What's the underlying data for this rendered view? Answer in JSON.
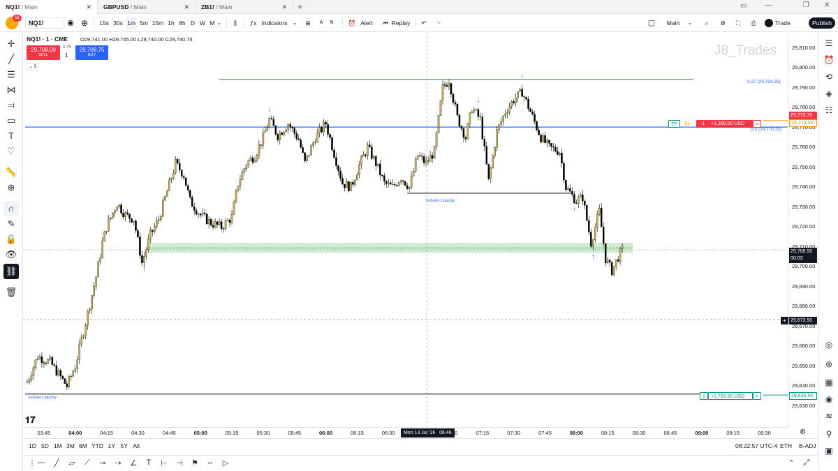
{
  "browser_tabs": [
    {
      "symbol": "NQ1!",
      "layout": "/ Main"
    },
    {
      "symbol": "GBPUSD",
      "layout": "/ Main"
    },
    {
      "symbol": "ZB1!",
      "layout": "/ Main"
    }
  ],
  "toolbar": {
    "avatar_badge": "11",
    "symbol": "NQ1!",
    "intervals": [
      "15s",
      "30s",
      "1m",
      "5m",
      "15m",
      "1h",
      "8h",
      "D",
      "W",
      "M"
    ],
    "selected_interval": "1m",
    "indicators_label": "Indicators",
    "alert_label": "Alert",
    "replay_label": "Replay",
    "layout_label": "Main",
    "trade_label": "Trade",
    "publish_label": "Publish",
    "a_label": "A",
    "n_label": "N"
  },
  "legend": {
    "title": "NQ1! · 1 · CME",
    "ohlc": "O29,741.00 H29,745.00 L29,740.00 C29,740.75",
    "sell_price": "29,708.00",
    "sell_label": "SELL",
    "buy_price": "29,708.75",
    "buy_label": "BUY",
    "spread": "0.75",
    "qty": "1",
    "collapsed_count": "5"
  },
  "watermark": "J8_Trades",
  "chart_data": {
    "type": "candlestick",
    "symbol": "NQ1!",
    "interval": "1m",
    "x_range": [
      "03:36",
      "09:40"
    ],
    "ylim": [
      29630,
      29818
    ],
    "price_ticks": [
      29810,
      29800,
      29790,
      29780,
      29770,
      29760,
      29750,
      29740,
      29730,
      29720,
      29710,
      29700,
      29690,
      29680,
      29670,
      29660,
      29650,
      29640,
      29630
    ],
    "time_ticks": [
      "03:45",
      "04:00",
      "04:15",
      "04:30",
      "04:45",
      "05:00",
      "05:15",
      "05:30",
      "05:45",
      "06:00",
      "06:15",
      "06:30",
      "06:45",
      "07:00",
      "07:15",
      "07:30",
      "07:45",
      "08:00",
      "08:15",
      "08:30",
      "08:45",
      "09:00",
      "09:15",
      "09:30"
    ],
    "bold_time_ticks": [
      "04:00",
      "05:00",
      "06:00",
      "08:00",
      "09:00"
    ],
    "path_points": [
      [
        "03:37",
        29642
      ],
      [
        "03:42",
        29655
      ],
      [
        "03:48",
        29652
      ],
      [
        "03:52",
        29646
      ],
      [
        "03:56",
        29640
      ],
      [
        "04:00",
        29650
      ],
      [
        "04:05",
        29672
      ],
      [
        "04:10",
        29695
      ],
      [
        "04:13",
        29712
      ],
      [
        "04:15",
        29720
      ],
      [
        "04:20",
        29732
      ],
      [
        "04:24",
        29726
      ],
      [
        "04:28",
        29724
      ],
      [
        "04:32",
        29702
      ],
      [
        "04:36",
        29716
      ],
      [
        "04:40",
        29724
      ],
      [
        "04:44",
        29738
      ],
      [
        "04:48",
        29752
      ],
      [
        "04:52",
        29746
      ],
      [
        "04:55",
        29733
      ],
      [
        "05:00",
        29726
      ],
      [
        "05:05",
        29722
      ],
      [
        "05:10",
        29720
      ],
      [
        "05:15",
        29725
      ],
      [
        "05:18",
        29742
      ],
      [
        "05:22",
        29752
      ],
      [
        "05:26",
        29756
      ],
      [
        "05:30",
        29765
      ],
      [
        "05:33",
        29774
      ],
      [
        "05:37",
        29766
      ],
      [
        "05:42",
        29772
      ],
      [
        "05:47",
        29764
      ],
      [
        "05:50",
        29752
      ],
      [
        "05:55",
        29765
      ],
      [
        "06:00",
        29772
      ],
      [
        "06:04",
        29757
      ],
      [
        "06:08",
        29742
      ],
      [
        "06:12",
        29740
      ],
      [
        "06:16",
        29751
      ],
      [
        "06:20",
        29760
      ],
      [
        "06:24",
        29752
      ],
      [
        "06:28",
        29742
      ],
      [
        "06:32",
        29740
      ],
      [
        "06:36",
        29745
      ],
      [
        "06:40",
        29740
      ],
      [
        "06:44",
        29756
      ],
      [
        "06:48",
        29752
      ],
      [
        "06:52",
        29758
      ],
      [
        "06:56",
        29790
      ],
      [
        "06:59",
        29794
      ],
      [
        "07:03",
        29775
      ],
      [
        "07:07",
        29765
      ],
      [
        "07:10",
        29780
      ],
      [
        "07:14",
        29774
      ],
      [
        "07:18",
        29743
      ],
      [
        "07:22",
        29768
      ],
      [
        "07:26",
        29778
      ],
      [
        "07:30",
        29784
      ],
      [
        "07:34",
        29788
      ],
      [
        "07:38",
        29778
      ],
      [
        "07:43",
        29765
      ],
      [
        "07:47",
        29760
      ],
      [
        "07:52",
        29758
      ],
      [
        "07:55",
        29740
      ],
      [
        "08:00",
        29733
      ],
      [
        "08:03",
        29735
      ],
      [
        "08:07",
        29712
      ],
      [
        "08:11",
        29728
      ],
      [
        "08:14",
        29704
      ],
      [
        "08:17",
        29698
      ],
      [
        "08:20",
        29705
      ],
      [
        "08:22",
        29708.5
      ]
    ],
    "markers": {
      "down_arrows": [
        [
          "05:33",
          29778
        ],
        [
          "07:13",
          29783
        ],
        [
          "07:34",
          29795
        ]
      ],
      "up_arrows": [
        [
          "04:33",
          29700
        ],
        [
          "07:59",
          29730
        ],
        [
          "08:08",
          29706
        ]
      ]
    },
    "annotations": [
      {
        "type": "hline",
        "label": "Sellside Liquidity",
        "price": 29636,
        "from": "03:36",
        "to": "09:18",
        "color": "#000000"
      },
      {
        "type": "hline",
        "label": "Sellside Liquidity",
        "price": 29737,
        "from": "06:39",
        "to": "07:58",
        "color": "#000000"
      },
      {
        "type": "hline",
        "label": "0.27 (29,794.25)",
        "price": 29794.25,
        "from": "05:09",
        "to": "08:56",
        "color": "#2962ff"
      },
      {
        "type": "hline",
        "label": "0.5 (29,770.25)",
        "price": 29770.25,
        "from": "03:36",
        "to": "09:40",
        "color": "#2962ff"
      },
      {
        "type": "zone",
        "top": 29712,
        "bottom": 29707,
        "from": "04:35",
        "to": "08:27",
        "color": "#4caf50"
      }
    ]
  },
  "price_axis": {
    "current_price": "29,708.50",
    "current_countdown": "00:03",
    "ask_price": "29,773.75",
    "tp_price": "29,773.50",
    "crosshair_price": "29,673.50",
    "order_price": "29,635.50"
  },
  "position_line": {
    "tp_label": "TP",
    "sl_label": "SL",
    "qty": "-1",
    "pnl": "+1,300.00 USD",
    "close": "×"
  },
  "order_line": {
    "qty": "1",
    "pnl": "+2,765.00 USD",
    "close": "×"
  },
  "crosshair_date": "Mon 13 Jul '26   06:46",
  "bottom_bar": {
    "ranges": [
      "1D",
      "5D",
      "1M",
      "3M",
      "6M",
      "YTD",
      "1Y",
      "5Y",
      "All"
    ],
    "clock": "08:22:57 UTC-4",
    "eth": "ETH",
    "badj": "B-ADJ"
  },
  "colors": {
    "bull_candle": "#c8b560",
    "bear_candle": "#000000",
    "fib_line": "#2962ff",
    "zone": "#4caf50",
    "accent": "#2962ff",
    "sell": "#f23645",
    "buy": "#2962ff"
  }
}
